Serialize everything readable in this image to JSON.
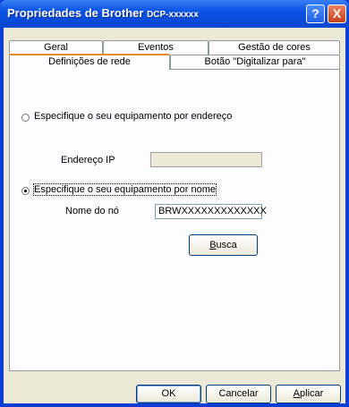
{
  "window": {
    "title": "Propriedades de Brother",
    "model": "DCP-xxxxxx",
    "help_label": "?",
    "close_label": "X"
  },
  "tabs_back": [
    "Geral",
    "Eventos",
    "Gestão de cores"
  ],
  "tabs_front": [
    "Definições de rede",
    "Botão \"Digitalizar para\""
  ],
  "by_address": {
    "label": "Especifique o seu equipamento por endereço",
    "ip_label": "Endereço IP",
    "ip_value": ""
  },
  "by_name": {
    "label": "Especifique o seu equipamento por nome",
    "node_label": "Nome do nó",
    "node_value": "BRWXXXXXXXXXXXXX"
  },
  "buttons": {
    "search": "Busca",
    "ok": "OK",
    "cancel": "Cancelar",
    "apply": "Aplicar"
  }
}
